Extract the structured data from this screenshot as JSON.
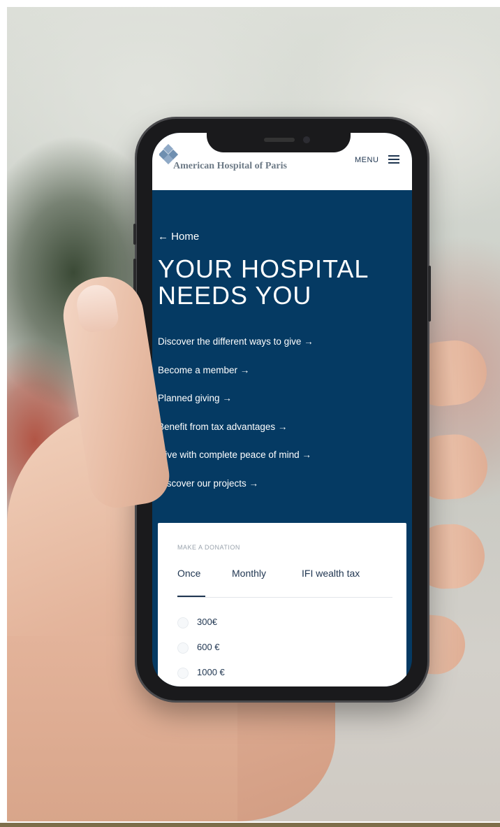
{
  "colors": {
    "brand_navy": "#053a63",
    "header_bg": "#ffffff",
    "logo_blue": "#6f8fb0"
  },
  "header": {
    "logo_text": "American Hospital of Paris",
    "menu_label": "MENU",
    "logo_icon": "cross-logo-icon",
    "menu_icon": "hamburger-icon"
  },
  "hero": {
    "back_link": "← Home",
    "title_line1": "YOUR HOSPITAL",
    "title_line2": "NEEDS YOU"
  },
  "links": [
    {
      "label": "Discover the different ways to give →"
    },
    {
      "label": "Become a member →"
    },
    {
      "label": "Planned giving →"
    },
    {
      "label": "Benefit from tax advantages →"
    },
    {
      "label": "Give with complete peace of mind →"
    },
    {
      "label": "Discover our projects →"
    }
  ],
  "donation": {
    "heading": "MAKE A DONATION",
    "tabs": [
      {
        "label": "Once",
        "selected": true
      },
      {
        "label": "Monthly",
        "selected": false
      },
      {
        "label": "IFI wealth tax",
        "selected": false
      }
    ],
    "amounts": [
      {
        "label": "300€"
      },
      {
        "label": "600 €"
      },
      {
        "label": "1000 €"
      }
    ]
  }
}
